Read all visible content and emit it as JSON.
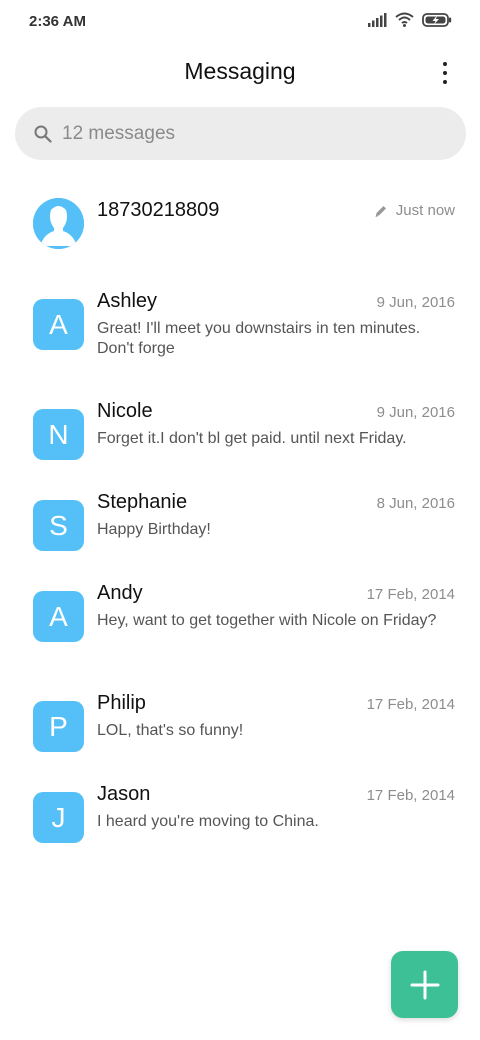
{
  "status_bar": {
    "time": "2:36 AM"
  },
  "header": {
    "title": "Messaging"
  },
  "search": {
    "text": "12 messages"
  },
  "conversations": [
    {
      "name": "18730218809",
      "date": "Just now",
      "snippet": "",
      "avatar": "contact-silhouette",
      "draft": true
    },
    {
      "name": "Ashley",
      "date": "9 Jun, 2016",
      "snippet": "Great! I'll meet you downstairs in ten minutes. Don't forge",
      "avatar": "A"
    },
    {
      "name": "Nicole",
      "date": "9 Jun, 2016",
      "snippet": "Forget it.I don't bl get paid. until next Friday.",
      "avatar": "N"
    },
    {
      "name": "Stephanie",
      "date": "8 Jun, 2016",
      "snippet": "Happy Birthday!",
      "avatar": "S"
    },
    {
      "name": "Andy",
      "date": "17 Feb, 2014",
      "snippet": "Hey, want to get together with Nicole on Friday?",
      "avatar": "A"
    },
    {
      "name": "Philip",
      "date": "17 Feb, 2014",
      "snippet": "LOL, that's so funny!",
      "avatar": "P"
    },
    {
      "name": "Jason",
      "date": "17 Feb, 2014",
      "snippet": "I heard you're moving to China.",
      "avatar": "J"
    }
  ],
  "colors": {
    "avatar": "#55c0f8",
    "fab": "#3ec096",
    "search_bg": "#ececec"
  },
  "icons": {
    "fab": "plus-icon",
    "search": "search-icon",
    "draft": "pencil-icon",
    "menu": "more-vert-icon"
  }
}
